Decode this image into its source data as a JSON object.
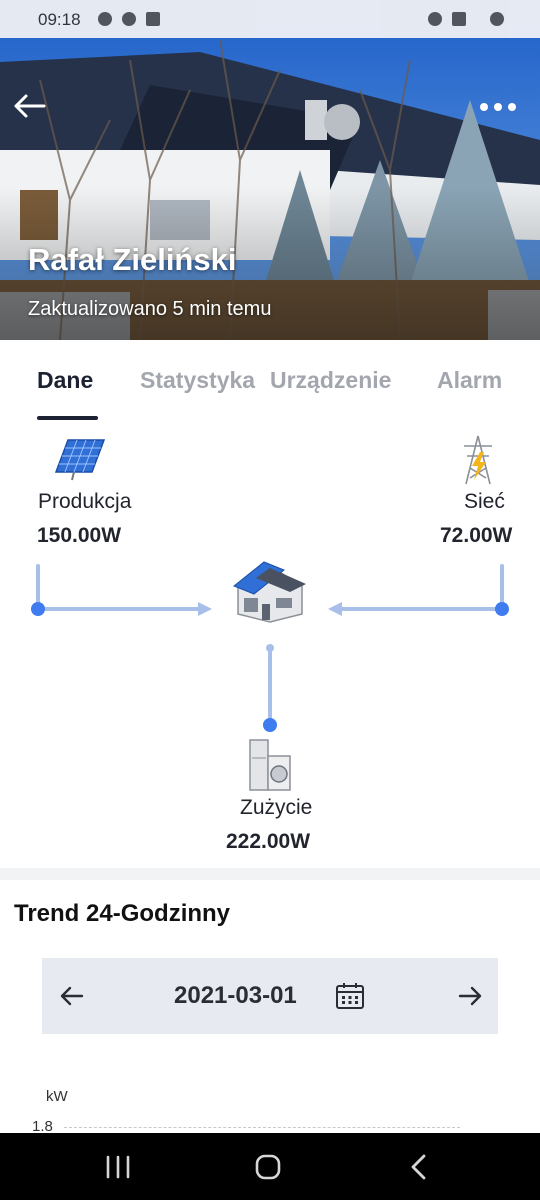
{
  "status_bar": {
    "time": "09:18"
  },
  "header": {
    "title": "Rafał Zieliński",
    "subtitle": "Zaktualizowano 5 min temu",
    "back_icon": "arrow-left-icon",
    "more_icon": "more-dots-icon"
  },
  "tabs": [
    {
      "label": "Dane",
      "active": true
    },
    {
      "label": "Statystyka"
    },
    {
      "label": "Urządzenie"
    },
    {
      "label": "Alarm"
    }
  ],
  "flow": {
    "production": {
      "label": "Produkcja",
      "value": "150.00W",
      "icon": "solar-panel-icon"
    },
    "grid": {
      "label": "Sieć",
      "value": "72.00W",
      "icon": "power-tower-icon"
    },
    "consumption": {
      "label": "Zużycie",
      "value": "222.00W",
      "icon": "appliances-icon"
    },
    "house_icon": "house-icon",
    "line_color": "#a8bfe9",
    "dot_color": "#3e7cf0"
  },
  "trend": {
    "title": "Trend 24-Godzinny",
    "date": "2021-03-01",
    "unit": "kW",
    "y_tick": "1.8"
  }
}
